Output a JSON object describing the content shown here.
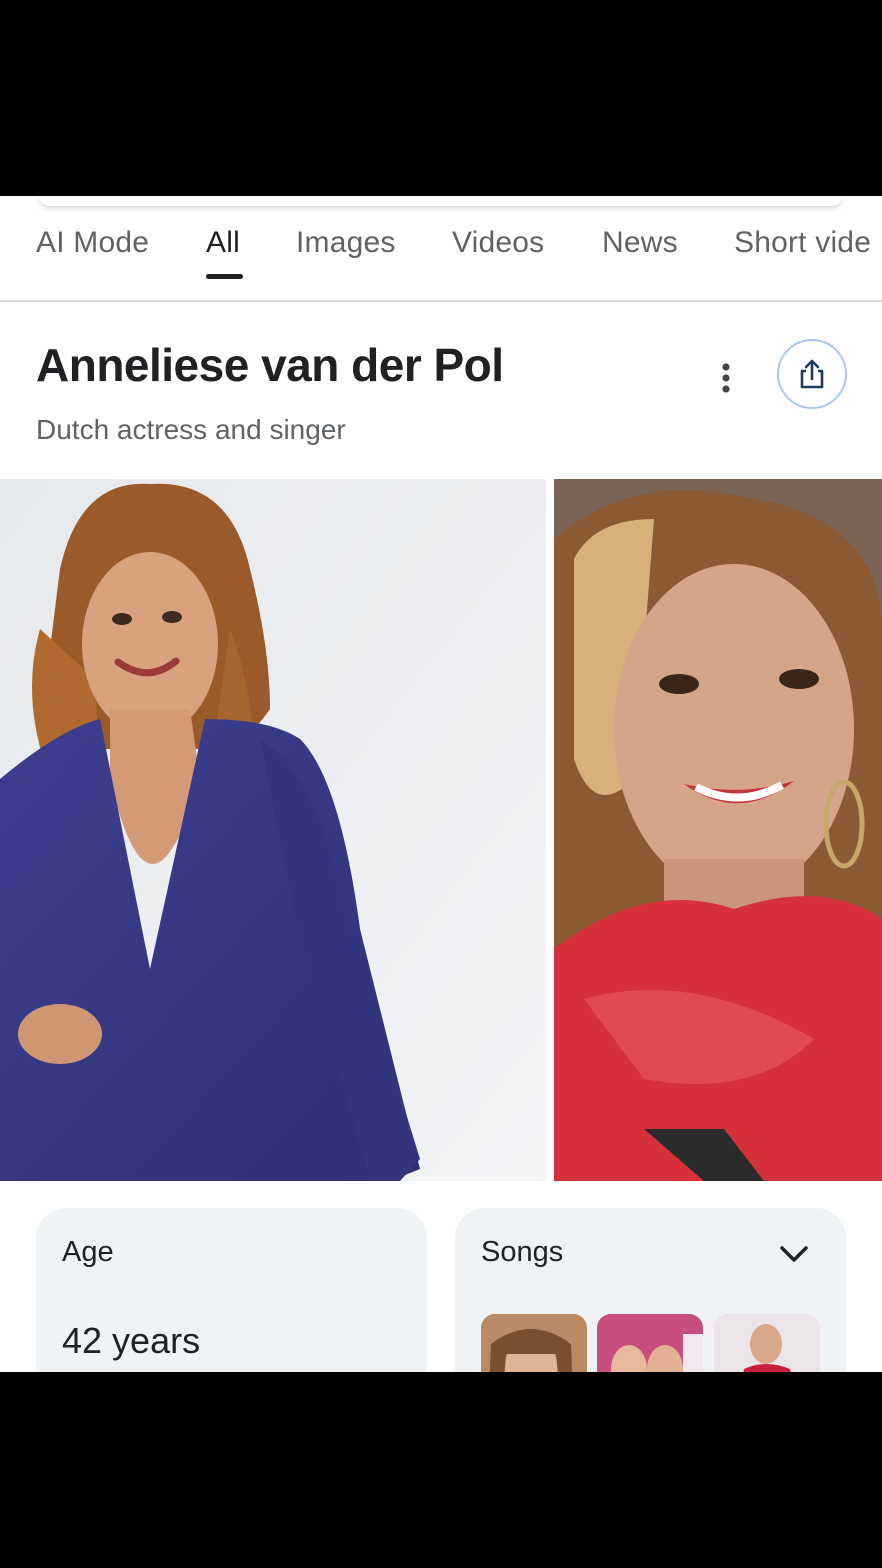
{
  "tabs": [
    {
      "label": "AI Mode"
    },
    {
      "label": "All"
    },
    {
      "label": "Images"
    },
    {
      "label": "Videos"
    },
    {
      "label": "News"
    },
    {
      "label": "Short vide"
    }
  ],
  "active_tab": "All",
  "knowledge_panel": {
    "title": "Anneliese van der Pol",
    "subtitle": "Dutch actress and singer"
  },
  "icons": {
    "more": "more-vert-icon",
    "share": "share-icon",
    "expand": "chevron-down-icon"
  },
  "cards": {
    "age": {
      "label": "Age",
      "value": "42 years"
    },
    "songs": {
      "label": "Songs"
    }
  },
  "colors": {
    "share_border": "#a8c7fa",
    "card_bg": "#f0f3f5",
    "text_primary": "#202124",
    "text_secondary": "#5f6368"
  }
}
